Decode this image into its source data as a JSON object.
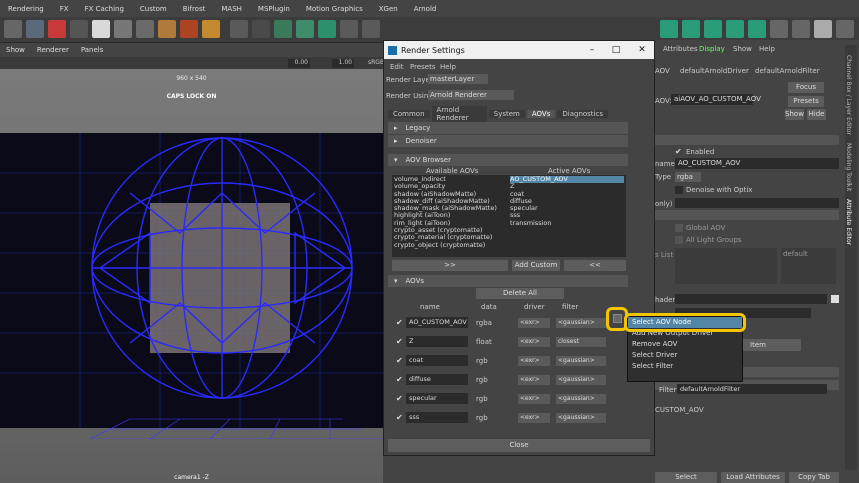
{
  "menubar": [
    "Rendering",
    "FX",
    "FX Caching",
    "Custom",
    "Bifrost",
    "MASH",
    "MSPlugin",
    "Motion Graphics",
    "XGen",
    "Arnold"
  ],
  "panel_menu": [
    "Show",
    "Renderer",
    "Panels"
  ],
  "viewport": {
    "zoom_a": "0.00",
    "zoom_b": "1.00",
    "color_space": "sRGB",
    "resolution": "960 x 540",
    "caps_lock": "CAPS LOCK ON",
    "camera": "camera1 -Z"
  },
  "right_panel": {
    "tabs": [
      "Attributes",
      "Display",
      "Show",
      "Help"
    ],
    "node_tabs": [
      "AOV",
      "defaultArnoldDriver",
      "defaultArnoldFilter"
    ],
    "aov_label": "AOV:",
    "aov_value": "aiAOV_AO_CUSTOM_AOV",
    "focus": "Focus",
    "presets": "Presets",
    "show": "Show",
    "hide": "Hide",
    "enabled": "Enabled",
    "name_label": "name",
    "name_value": "AO_CUSTOM_AOV",
    "type_label": "Type",
    "type_value": "rgba",
    "denoise": "Denoise with Optix",
    "only": "only)",
    "global_aov": "Global AOV",
    "all_light_groups": "All Light Groups",
    "list_label": "s List",
    "default_value": "default",
    "shader_label": "hader",
    "item_btn": "Item",
    "filter_label": "Filter",
    "filter_value": "defaultArnoldFilter",
    "custom_aov": "CUSTOM_AOV",
    "bottom_buttons": [
      "Select",
      "Load Attributes",
      "Copy Tab"
    ],
    "side_tabs": [
      "Channel Box / Layer Editor",
      "Modeling Toolkit",
      "Attribute Editor"
    ]
  },
  "window": {
    "title": "Render Settings",
    "menu": [
      "Edit",
      "Presets",
      "Help"
    ],
    "render_layer_label": "Render Layer",
    "render_layer_value": "masterLayer",
    "render_using_label": "Render Using",
    "render_using_value": "Arnold Renderer",
    "tabs": [
      "Common",
      "Arnold Renderer",
      "System",
      "AOVs",
      "Diagnostics"
    ],
    "sections": {
      "legacy": "Legacy",
      "denoiser": "Denoiser",
      "aov_browser": "AOV Browser",
      "aovs": "AOVs"
    },
    "available_header": "Available AOVs",
    "active_header": "Active AOVs",
    "available": [
      "volume_indirect",
      "volume_opacity",
      "shadow (aiShadowMatte)",
      "shadow_diff (aiShadowMatte)",
      "shadow_mask (aiShadowMatte)",
      "highlight (aiToon)",
      "rim_light (aiToon)",
      "crypto_asset (cryptomatte)",
      "crypto_material (cryptomatte)",
      "crypto_object (cryptomatte)"
    ],
    "active": [
      "AO_CUSTOM_AOV",
      "Z",
      "coat",
      "diffuse",
      "specular",
      "sss",
      "transmission"
    ],
    "add_btn": ">>",
    "add_custom_btn": "Add Custom",
    "remove_btn": "<<",
    "delete_all": "Delete All",
    "columns": [
      "name",
      "data",
      "driver",
      "filter"
    ],
    "rows": [
      {
        "name": "AO_CUSTOM_AOV",
        "data": "rgba",
        "driver": "<exr>",
        "filter": "<gaussian>"
      },
      {
        "name": "Z",
        "data": "float",
        "driver": "<exr>",
        "filter": "closest"
      },
      {
        "name": "coat",
        "data": "rgb",
        "driver": "<exr>",
        "filter": "<gaussian>"
      },
      {
        "name": "diffuse",
        "data": "rgb",
        "driver": "<exr>",
        "filter": "<gaussian>"
      },
      {
        "name": "specular",
        "data": "rgb",
        "driver": "<exr>",
        "filter": "<gaussian>"
      },
      {
        "name": "sss",
        "data": "rgb",
        "driver": "<exr>",
        "filter": "<gaussian>"
      }
    ],
    "close": "Close"
  },
  "context_menu": [
    "Select AOV Node",
    "Add New Output Driver",
    "Remove AOV",
    "Select Driver",
    "Select Filter"
  ],
  "colors": {
    "highlight": "#f2c500",
    "selected": "#5285a6",
    "wire": "#2a2aff"
  }
}
